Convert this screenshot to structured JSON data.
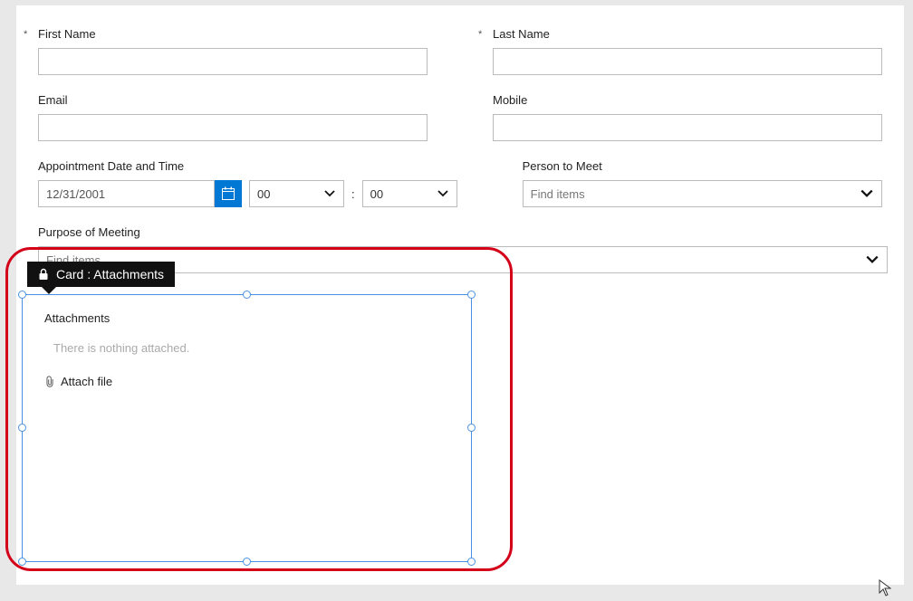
{
  "fields": {
    "first_name": {
      "label": "First Name",
      "required": true,
      "value": ""
    },
    "last_name": {
      "label": "Last Name",
      "required": true,
      "value": ""
    },
    "email": {
      "label": "Email",
      "value": ""
    },
    "mobile": {
      "label": "Mobile",
      "value": ""
    },
    "appt": {
      "label": "Appointment Date and Time",
      "date": "12/31/2001",
      "hour": "00",
      "minute": "00",
      "sep": ":"
    },
    "person": {
      "label": "Person to Meet",
      "placeholder": "Find items"
    },
    "purpose": {
      "label": "Purpose of Meeting",
      "placeholder": "Find items"
    }
  },
  "attachments": {
    "tooltip": "Card : Attachments",
    "heading": "Attachments",
    "empty_text": "There is nothing attached.",
    "attach_label": "Attach file"
  }
}
